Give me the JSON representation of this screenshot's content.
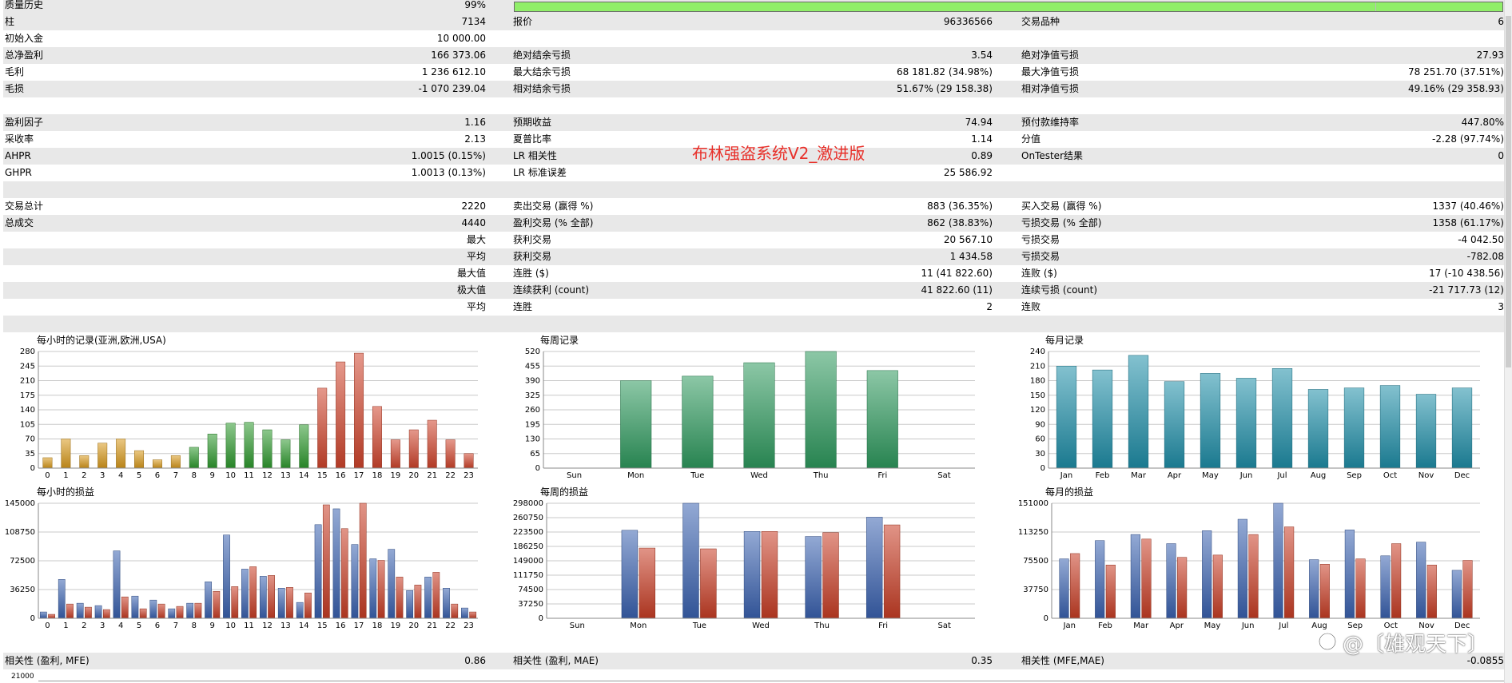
{
  "stats": [
    {
      "shaded": true,
      "cells": [
        {
          "x": 6,
          "text": "质量历史"
        },
        {
          "x": 460,
          "w": 148,
          "text": "99%",
          "align": "r"
        }
      ]
    },
    {
      "shaded": true,
      "cells": [
        {
          "x": 6,
          "text": "柱"
        },
        {
          "x": 460,
          "w": 148,
          "text": "7134",
          "align": "r"
        },
        {
          "x": 642,
          "text": "报价"
        },
        {
          "x": 1080,
          "w": 162,
          "text": "96336566",
          "align": "r"
        },
        {
          "x": 1278,
          "text": "交易品种"
        },
        {
          "x": 1720,
          "w": 162,
          "text": "6",
          "align": "r"
        }
      ]
    },
    {
      "shaded": false,
      "cells": [
        {
          "x": 6,
          "text": "初始入金"
        },
        {
          "x": 460,
          "w": 148,
          "text": "10 000.00",
          "align": "r"
        }
      ]
    },
    {
      "shaded": true,
      "cells": [
        {
          "x": 6,
          "text": "总净盈利"
        },
        {
          "x": 460,
          "w": 148,
          "text": "166 373.06",
          "align": "r"
        },
        {
          "x": 642,
          "text": "绝对结余亏损"
        },
        {
          "x": 1080,
          "w": 162,
          "text": "3.54",
          "align": "r"
        },
        {
          "x": 1278,
          "text": "绝对净值亏损"
        },
        {
          "x": 1720,
          "w": 162,
          "text": "27.93",
          "align": "r"
        }
      ]
    },
    {
      "shaded": false,
      "cells": [
        {
          "x": 6,
          "text": "毛利"
        },
        {
          "x": 460,
          "w": 148,
          "text": "1 236 612.10",
          "align": "r"
        },
        {
          "x": 642,
          "text": "最大结余亏损"
        },
        {
          "x": 1080,
          "w": 162,
          "text": "68 181.82 (34.98%)",
          "align": "r"
        },
        {
          "x": 1278,
          "text": "最大净值亏损"
        },
        {
          "x": 1720,
          "w": 162,
          "text": "78 251.70 (37.51%)",
          "align": "r"
        }
      ]
    },
    {
      "shaded": true,
      "cells": [
        {
          "x": 6,
          "text": "毛损"
        },
        {
          "x": 460,
          "w": 148,
          "text": "-1 070 239.04",
          "align": "r"
        },
        {
          "x": 642,
          "text": "相对结余亏损"
        },
        {
          "x": 1080,
          "w": 162,
          "text": "51.67% (29 158.38)",
          "align": "r"
        },
        {
          "x": 1278,
          "text": "相对净值亏损"
        },
        {
          "x": 1720,
          "w": 162,
          "text": "49.16% (29 358.93)",
          "align": "r"
        }
      ]
    },
    {
      "shaded": false,
      "cells": []
    },
    {
      "shaded": true,
      "cells": [
        {
          "x": 6,
          "text": "盈利因子"
        },
        {
          "x": 460,
          "w": 148,
          "text": "1.16",
          "align": "r"
        },
        {
          "x": 642,
          "text": "预期收益"
        },
        {
          "x": 1080,
          "w": 162,
          "text": "74.94",
          "align": "r"
        },
        {
          "x": 1278,
          "text": "预付款维持率"
        },
        {
          "x": 1720,
          "w": 162,
          "text": "447.80%",
          "align": "r"
        }
      ]
    },
    {
      "shaded": false,
      "cells": [
        {
          "x": 6,
          "text": "采收率"
        },
        {
          "x": 460,
          "w": 148,
          "text": "2.13",
          "align": "r"
        },
        {
          "x": 642,
          "text": "夏普比率"
        },
        {
          "x": 1080,
          "w": 162,
          "text": "1.14",
          "align": "r"
        },
        {
          "x": 1278,
          "text": "分值"
        },
        {
          "x": 1720,
          "w": 162,
          "text": "-2.28 (97.74%)",
          "align": "r"
        }
      ]
    },
    {
      "shaded": true,
      "cells": [
        {
          "x": 6,
          "text": "AHPR"
        },
        {
          "x": 460,
          "w": 148,
          "text": "1.0015 (0.15%)",
          "align": "r"
        },
        {
          "x": 642,
          "text": "LR 相关性"
        },
        {
          "x": 1080,
          "w": 162,
          "text": "0.89",
          "align": "r"
        },
        {
          "x": 1278,
          "text": "OnTester结果"
        },
        {
          "x": 1720,
          "w": 162,
          "text": "0",
          "align": "r"
        }
      ]
    },
    {
      "shaded": false,
      "cells": [
        {
          "x": 6,
          "text": "GHPR"
        },
        {
          "x": 460,
          "w": 148,
          "text": "1.0013 (0.13%)",
          "align": "r"
        },
        {
          "x": 642,
          "text": "LR 标准误差"
        },
        {
          "x": 1080,
          "w": 162,
          "text": "25 586.92",
          "align": "r"
        }
      ]
    },
    {
      "shaded": true,
      "cells": []
    },
    {
      "shaded": false,
      "cells": [
        {
          "x": 6,
          "text": "交易总计"
        },
        {
          "x": 460,
          "w": 148,
          "text": "2220",
          "align": "r"
        },
        {
          "x": 642,
          "text": "卖出交易 (赢得 %)"
        },
        {
          "x": 1080,
          "w": 162,
          "text": "883 (36.35%)",
          "align": "r"
        },
        {
          "x": 1278,
          "text": "买入交易 (赢得 %)"
        },
        {
          "x": 1720,
          "w": 162,
          "text": "1337 (40.46%)",
          "align": "r"
        }
      ]
    },
    {
      "shaded": true,
      "cells": [
        {
          "x": 6,
          "text": "总成交"
        },
        {
          "x": 460,
          "w": 148,
          "text": "4440",
          "align": "r"
        },
        {
          "x": 642,
          "text": "盈利交易 (% 全部)"
        },
        {
          "x": 1080,
          "w": 162,
          "text": "862 (38.83%)",
          "align": "r"
        },
        {
          "x": 1278,
          "text": "亏损交易 (% 全部)"
        },
        {
          "x": 1720,
          "w": 162,
          "text": "1358 (61.17%)",
          "align": "r"
        }
      ]
    },
    {
      "shaded": false,
      "cells": [
        {
          "x": 460,
          "w": 148,
          "text": "最大",
          "align": "r"
        },
        {
          "x": 642,
          "text": "获利交易"
        },
        {
          "x": 1080,
          "w": 162,
          "text": "20 567.10",
          "align": "r"
        },
        {
          "x": 1278,
          "text": "亏损交易"
        },
        {
          "x": 1720,
          "w": 162,
          "text": "-4 042.50",
          "align": "r"
        }
      ]
    },
    {
      "shaded": true,
      "cells": [
        {
          "x": 460,
          "w": 148,
          "text": "平均",
          "align": "r"
        },
        {
          "x": 642,
          "text": "获利交易"
        },
        {
          "x": 1080,
          "w": 162,
          "text": "1 434.58",
          "align": "r"
        },
        {
          "x": 1278,
          "text": "亏损交易"
        },
        {
          "x": 1720,
          "w": 162,
          "text": "-782.08",
          "align": "r"
        }
      ]
    },
    {
      "shaded": false,
      "cells": [
        {
          "x": 460,
          "w": 148,
          "text": "最大值",
          "align": "r"
        },
        {
          "x": 642,
          "text": "连胜 ($)"
        },
        {
          "x": 1080,
          "w": 162,
          "text": "11 (41 822.60)",
          "align": "r"
        },
        {
          "x": 1278,
          "text": "连败 ($)"
        },
        {
          "x": 1720,
          "w": 162,
          "text": "17 (-10 438.56)",
          "align": "r"
        }
      ]
    },
    {
      "shaded": true,
      "cells": [
        {
          "x": 460,
          "w": 148,
          "text": "极大值",
          "align": "r"
        },
        {
          "x": 642,
          "text": "连续获利 (count)"
        },
        {
          "x": 1080,
          "w": 162,
          "text": "41 822.60 (11)",
          "align": "r"
        },
        {
          "x": 1278,
          "text": "连续亏损 (count)"
        },
        {
          "x": 1720,
          "w": 162,
          "text": "-21 717.73 (12)",
          "align": "r"
        }
      ]
    },
    {
      "shaded": false,
      "cells": [
        {
          "x": 460,
          "w": 148,
          "text": "平均",
          "align": "r"
        },
        {
          "x": 642,
          "text": "连胜"
        },
        {
          "x": 1080,
          "w": 162,
          "text": "2",
          "align": "r"
        },
        {
          "x": 1278,
          "text": "连败"
        },
        {
          "x": 1720,
          "w": 162,
          "text": "3",
          "align": "r"
        }
      ]
    },
    {
      "shaded": true,
      "cells": []
    }
  ],
  "system_title": "布林强盗系统V2_激进版",
  "chart_data": [
    {
      "id": "hourly-records",
      "type": "bar",
      "title": "每小时的记录(亚洲,欧洲,USA)",
      "categories": [
        "0",
        "1",
        "2",
        "3",
        "4",
        "5",
        "6",
        "7",
        "8",
        "9",
        "10",
        "11",
        "12",
        "13",
        "14",
        "15",
        "16",
        "17",
        "18",
        "19",
        "20",
        "21",
        "22",
        "23"
      ],
      "values": [
        25,
        70,
        30,
        60,
        70,
        42,
        20,
        30,
        50,
        82,
        108,
        110,
        92,
        68,
        104,
        192,
        255,
        276,
        148,
        68,
        92,
        115,
        68,
        35
      ],
      "colors": [
        "#d99a1c",
        "#d99a1c",
        "#d99a1c",
        "#d99a1c",
        "#d99a1c",
        "#d99a1c",
        "#d99a1c",
        "#d99a1c",
        "#2e9a2e",
        "#2e9a2e",
        "#2e9a2e",
        "#2e9a2e",
        "#2e9a2e",
        "#2e9a2e",
        "#2e9a2e",
        "#d0442c",
        "#d0442c",
        "#d0442c",
        "#d0442c",
        "#d0442c",
        "#d0442c",
        "#d0442c",
        "#d0442c",
        "#d0442c"
      ],
      "yticks": [
        "280",
        "245",
        "210",
        "175",
        "140",
        "105",
        "70",
        "35",
        "0"
      ],
      "ylim": [
        0,
        280
      ]
    },
    {
      "id": "weekly-records",
      "type": "bar",
      "title": "每周记录",
      "categories": [
        "Sun",
        "Mon",
        "Tue",
        "Wed",
        "Thu",
        "Fri",
        "Sat"
      ],
      "values": [
        0,
        390,
        410,
        470,
        520,
        435,
        0
      ],
      "colors": [
        "#2e9a5e"
      ],
      "yticks": [
        "520",
        "455",
        "390",
        "325",
        "260",
        "195",
        "130",
        "65",
        "0"
      ],
      "ylim": [
        0,
        520
      ]
    },
    {
      "id": "monthly-records",
      "type": "bar",
      "title": "每月记录",
      "categories": [
        "Jan",
        "Feb",
        "Mar",
        "Apr",
        "May",
        "Jun",
        "Jul",
        "Aug",
        "Sep",
        "Oct",
        "Nov",
        "Dec"
      ],
      "values": [
        210,
        202,
        232,
        178,
        195,
        185,
        205,
        162,
        165,
        170,
        152,
        165
      ],
      "colors": [
        "#1e8ea8"
      ],
      "yticks": [
        "240",
        "210",
        "180",
        "150",
        "120",
        "90",
        "60",
        "30",
        "0"
      ],
      "ylim": [
        0,
        240
      ]
    },
    {
      "id": "hourly-pnl",
      "type": "bar",
      "title": "每小时的损益",
      "categories": [
        "0",
        "1",
        "2",
        "3",
        "4",
        "5",
        "6",
        "7",
        "8",
        "9",
        "10",
        "11",
        "12",
        "13",
        "14",
        "15",
        "16",
        "17",
        "18",
        "19",
        "20",
        "21",
        "22",
        "23"
      ],
      "series": [
        {
          "values": [
            8000,
            49000,
            19000,
            16000,
            85000,
            28000,
            23000,
            12000,
            19000,
            46000,
            105000,
            62000,
            53000,
            38000,
            20000,
            118000,
            138000,
            93000,
            75000,
            87000,
            35000,
            52000,
            38000,
            13000
          ],
          "color": "#3a62b0"
        },
        {
          "values": [
            5000,
            18000,
            14000,
            11000,
            27000,
            12000,
            18000,
            15000,
            19000,
            34000,
            40000,
            65000,
            54000,
            39000,
            32000,
            143000,
            113000,
            145000,
            73000,
            52000,
            42000,
            58000,
            18000,
            8000
          ],
          "color": "#c83d24"
        }
      ],
      "yticks": [
        "145000",
        "108750",
        "72500",
        "36250",
        "0"
      ],
      "ylim": [
        0,
        145000
      ]
    },
    {
      "id": "weekly-pnl",
      "type": "bar",
      "title": "每周的损益",
      "categories": [
        "Sun",
        "Mon",
        "Tue",
        "Wed",
        "Thu",
        "Fri",
        "Sat"
      ],
      "series": [
        {
          "values": [
            0,
            228000,
            298000,
            225000,
            212000,
            262000,
            0
          ],
          "color": "#3a62b0"
        },
        {
          "values": [
            0,
            182000,
            180000,
            225000,
            222000,
            242000,
            0
          ],
          "color": "#c83d24"
        }
      ],
      "yticks": [
        "298000",
        "260750",
        "223500",
        "186250",
        "149000",
        "111750",
        "74500",
        "37250",
        "0"
      ],
      "ylim": [
        0,
        298000
      ]
    },
    {
      "id": "monthly-pnl",
      "type": "bar",
      "title": "每月的损益",
      "categories": [
        "Jan",
        "Feb",
        "Mar",
        "Apr",
        "May",
        "Jun",
        "Jul",
        "Aug",
        "Sep",
        "Oct",
        "Nov",
        "Dec"
      ],
      "series": [
        {
          "values": [
            78000,
            102000,
            110000,
            98000,
            115000,
            130000,
            151000,
            77000,
            116000,
            82000,
            100000,
            63000
          ],
          "color": "#3a62b0"
        },
        {
          "values": [
            85000,
            70000,
            104000,
            80000,
            83000,
            110000,
            120000,
            71000,
            78000,
            98000,
            70000,
            76000
          ],
          "color": "#c83d24"
        }
      ],
      "yticks": [
        "151000",
        "113250",
        "75500",
        "37750",
        "0"
      ],
      "ylim": [
        0,
        151000
      ]
    }
  ],
  "correlation": [
    {
      "x": 6,
      "text": "相关性 (盈利, MFE)"
    },
    {
      "x": 460,
      "w": 148,
      "text": "0.86",
      "align": "r"
    },
    {
      "x": 642,
      "text": "相关性 (盈利, MAE)"
    },
    {
      "x": 1080,
      "w": 162,
      "text": "0.35",
      "align": "r"
    },
    {
      "x": 1278,
      "text": "相关性 (MFE,MAE)"
    },
    {
      "x": 1720,
      "w": 162,
      "text": "-0.0855",
      "align": "r"
    }
  ],
  "bottom_axis_label": "21000",
  "watermark": "@〔雄观天下〕",
  "quality_bar_color": "#90ee69"
}
